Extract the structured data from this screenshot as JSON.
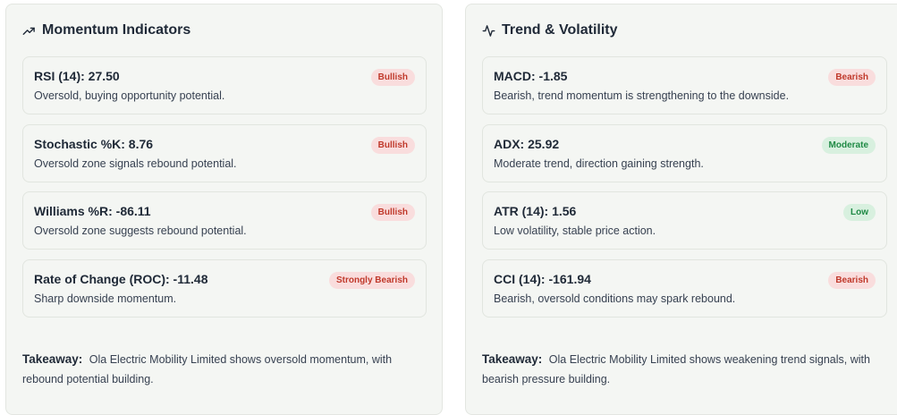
{
  "momentum": {
    "title": "Momentum Indicators",
    "icon": "trending-up-icon",
    "cards": [
      {
        "title": "RSI (14): 27.50",
        "desc": "Oversold, buying opportunity potential.",
        "badge": "Bullish",
        "badge_tone": "red"
      },
      {
        "title": "Stochastic %K: 8.76",
        "desc": "Oversold zone signals rebound potential.",
        "badge": "Bullish",
        "badge_tone": "red"
      },
      {
        "title": "Williams %R: -86.11",
        "desc": "Oversold zone suggests rebound potential.",
        "badge": "Bullish",
        "badge_tone": "red"
      },
      {
        "title": "Rate of Change (ROC): -11.48",
        "desc": "Sharp downside momentum.",
        "badge": "Strongly Bearish",
        "badge_tone": "red"
      }
    ],
    "takeaway_label": "Takeaway:",
    "takeaway_text": "Ola Electric Mobility Limited shows oversold momentum, with rebound potential building."
  },
  "trend": {
    "title": "Trend & Volatility",
    "icon": "activity-pulse-icon",
    "cards": [
      {
        "title": "MACD: -1.85",
        "desc": "Bearish, trend momentum is strengthening to the downside.",
        "badge": "Bearish",
        "badge_tone": "red"
      },
      {
        "title": "ADX: 25.92",
        "desc": "Moderate trend, direction gaining strength.",
        "badge": "Moderate",
        "badge_tone": "green"
      },
      {
        "title": "ATR (14): 1.56",
        "desc": "Low volatility, stable price action.",
        "badge": "Low",
        "badge_tone": "green"
      },
      {
        "title": "CCI (14): -161.94",
        "desc": "Bearish, oversold conditions may spark rebound.",
        "badge": "Bearish",
        "badge_tone": "red"
      }
    ],
    "takeaway_label": "Takeaway:",
    "takeaway_text": "Ola Electric Mobility Limited shows weakening trend signals, with bearish pressure building."
  },
  "colors": {
    "panel_bg": "#f4f6f3",
    "badge_red_bg": "#f9dddd",
    "badge_red_text": "#c0392b",
    "badge_green_bg": "#d8f0df",
    "badge_green_text": "#1f8a45"
  }
}
